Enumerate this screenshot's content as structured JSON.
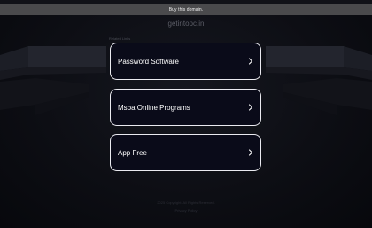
{
  "banner": {
    "label": "Buy this domain."
  },
  "domain": {
    "name": "getintopc.in"
  },
  "related": {
    "heading": "Related Links"
  },
  "links": [
    {
      "label": "Password Software",
      "icon": "chevron-right-icon"
    },
    {
      "label": "Msba Online Programs",
      "icon": "chevron-right-icon"
    },
    {
      "label": "App Free",
      "icon": "chevron-right-icon"
    }
  ],
  "footer": {
    "line1": "2025 Copyright. All Rights Reserved.",
    "line2": "Privacy Policy"
  },
  "colors": {
    "background": "#0b0c12",
    "card_border": "#eaeaf0",
    "card_fill": "#0a0b19",
    "banner": "#4a4a4c"
  }
}
